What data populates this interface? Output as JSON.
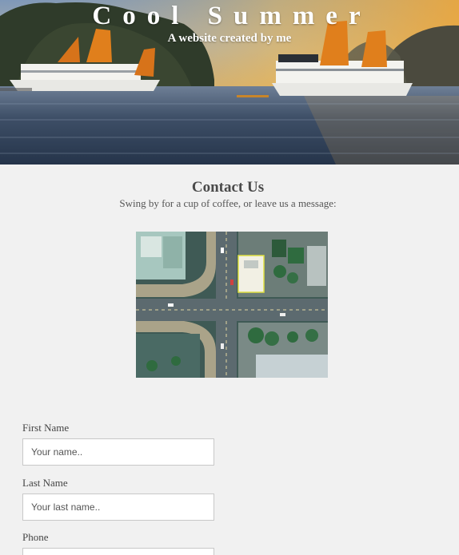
{
  "hero": {
    "title": "Cool Summer",
    "subtitle": "A website created by me"
  },
  "contact": {
    "title": "Contact Us",
    "subtitle": "Swing by for a cup of coffee, or leave us a message:"
  },
  "form": {
    "first_name": {
      "label": "First Name",
      "placeholder": "Your name.."
    },
    "last_name": {
      "label": "Last Name",
      "placeholder": "Your last name.."
    },
    "phone": {
      "label": "Phone",
      "placeholder": ""
    }
  }
}
